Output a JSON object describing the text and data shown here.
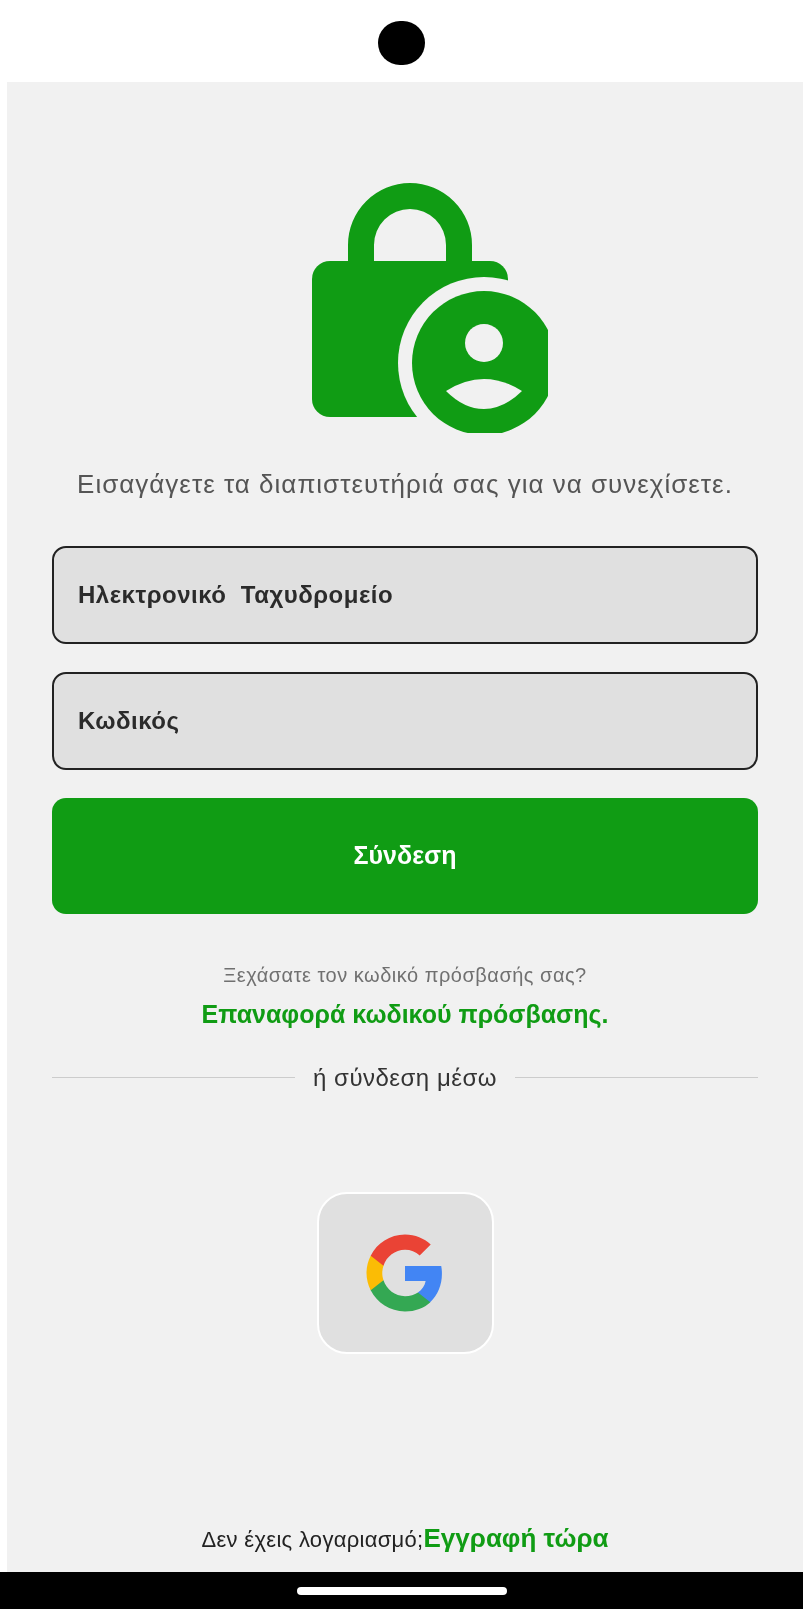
{
  "subtitle": "Εισαγάγετε τα διαπιστευτήριά σας για να συνεχίσετε.",
  "fields": [
    {
      "placeholder": "Ηλεκτρονικό  Ταχυδρομείο"
    },
    {
      "placeholder": "Κωδικός"
    }
  ],
  "login_button": "Σύνδεση",
  "forgot_text": "Ξεχάσατε τον κωδικό πρόσβασής σας?",
  "reset_link": "Επαναφορά κωδικού πρόσβασης.",
  "divider_text": "ή σύνδεση μέσω",
  "social_buttons": [
    {
      "kind": "google"
    }
  ],
  "signup_prompt": "Δεν έχεις λογαριασμό;",
  "signup_link": "Εγγραφή τώρα"
}
